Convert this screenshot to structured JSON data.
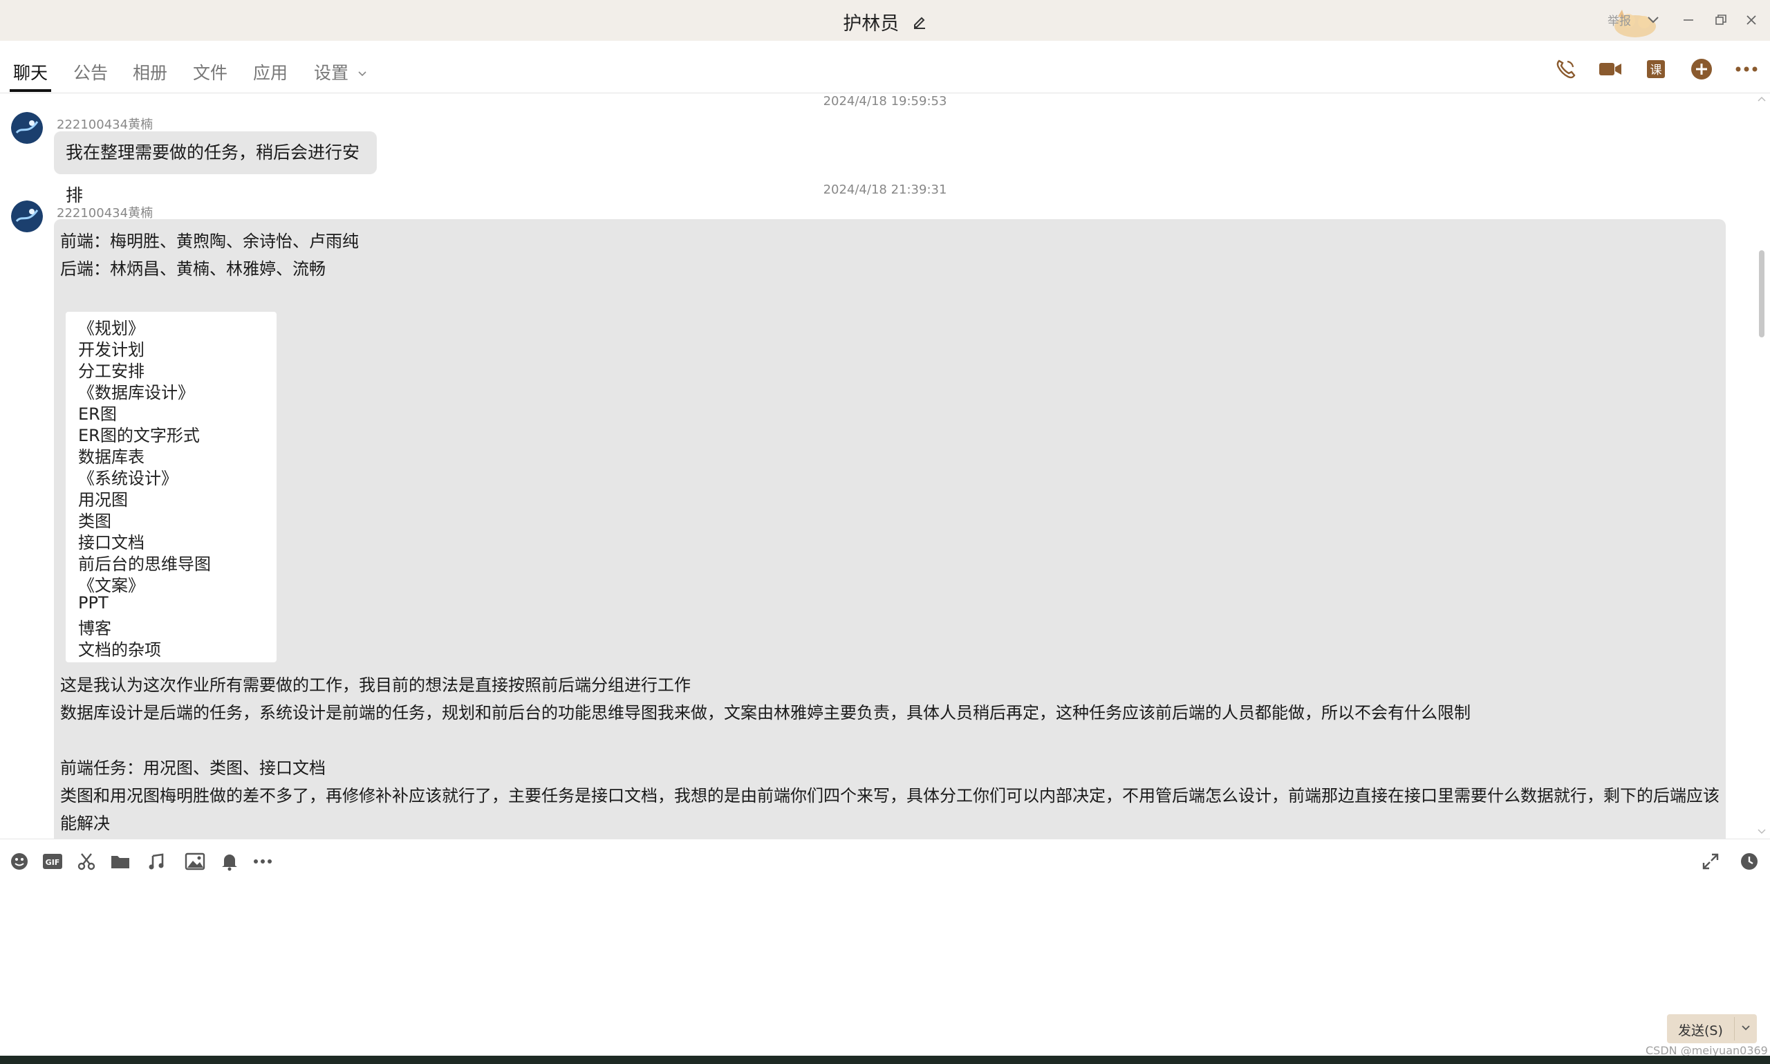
{
  "window": {
    "title": "护林员",
    "collapse_label": "举报",
    "colors": {
      "titlebar_bg": "#f2eee9",
      "accent_icon": "#8a5a2e"
    }
  },
  "tabs": [
    {
      "label": "聊天",
      "active": true
    },
    {
      "label": "公告"
    },
    {
      "label": "相册"
    },
    {
      "label": "文件"
    },
    {
      "label": "应用"
    },
    {
      "label": "设置"
    }
  ],
  "toolbar_icons": [
    "phone-icon",
    "video-icon",
    "lesson-icon",
    "add-icon",
    "more-icon"
  ],
  "messages": [
    {
      "timestamp": "2024/4/18 19:59:53",
      "sender": "222100434黄楠",
      "text": "我在整理需要做的任务，稍后会进行安排"
    },
    {
      "timestamp": "2024/4/18 21:39:31",
      "sender": "222100434黄楠",
      "lines_top": [
        "前端：梅明胜、黄煦陶、余诗怡、卢雨纯",
        "后端：林炳昌、黄楠、林雅婷、流畅"
      ],
      "doc_items": [
        "《规划》",
        "开发计划",
        "分工安排",
        "《数据库设计》",
        "ER图",
        "ER图的文字形式",
        "数据库表",
        "《系统设计》",
        "用况图",
        "类图",
        "接口文档",
        "前后台的思维导图",
        "《文案》",
        "PPT",
        "博客",
        "文档的杂项"
      ],
      "lines_bottom": [
        "这是我认为这次作业所有需要做的工作，我目前的想法是直接按照前后端分组进行工作",
        "数据库设计是后端的任务，系统设计是前端的任务，规划和前后台的功能思维导图我来做，文案由林雅婷主要负责，具体人员稍后再定，这种任务应该前后端的人员都能做，所以不会有什么限制",
        "",
        "前端任务：用况图、类图、接口文档",
        "类图和用况图梅明胜做的差不多了，再修修补补应该就行了，主要任务是接口文档，我想的是由前端你们四个来写，具体分工你们可以内部决定，不用管后端怎么设计，前端那边直接在接口里需要什么数据就行，剩下的后端应该",
        "能解决"
      ]
    }
  ],
  "input_toolbar_icons": [
    "emoji-icon",
    "gif-icon",
    "scissors-icon",
    "folder-icon",
    "music-icon",
    "image-icon",
    "bell-icon",
    "more-icon",
    "expand-icon",
    "history-icon"
  ],
  "send": {
    "label": "发送(S)"
  },
  "watermark": "CSDN @meiyuan0369"
}
